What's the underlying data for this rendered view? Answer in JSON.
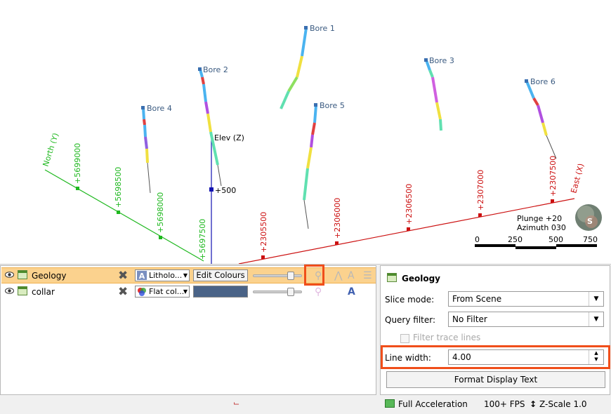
{
  "viewport": {
    "bores": [
      {
        "name": "Bore 1"
      },
      {
        "name": "Bore 2"
      },
      {
        "name": "Bore 3"
      },
      {
        "name": "Bore 4"
      },
      {
        "name": "Bore 5"
      },
      {
        "name": "Bore 6"
      }
    ],
    "axes": {
      "north_label": "North (Y)",
      "east_label": "East (X)",
      "elev_label": "Elev (Z)",
      "north_ticks": [
        "+5699000",
        "+5698500",
        "+5698000",
        "+5697500"
      ],
      "east_ticks": [
        "+2305500",
        "+2306000",
        "+2306500",
        "+2307000",
        "+2307500"
      ],
      "elev_ticks": [
        "+500"
      ]
    },
    "orientation": {
      "plunge": "Plunge +20",
      "azimuth": "Azimuth 030"
    },
    "scale_bar": [
      "0",
      "250",
      "500",
      "750"
    ],
    "compass_letter": "S",
    "colors": {
      "north": "#1fb81f",
      "east": "#cc1111",
      "elev": "#1313b0"
    }
  },
  "scene_list": {
    "rows": [
      {
        "name": "Geology",
        "colour_mode": "Litholo...",
        "colour_button": "Edit Colours",
        "selected": true
      },
      {
        "name": "collar",
        "colour_mode": "Flat col...",
        "swatch": "#4a6387",
        "selected": false
      }
    ]
  },
  "properties": {
    "title": "Geology",
    "slice_mode_label": "Slice mode:",
    "slice_mode_value": "From Scene",
    "query_filter_label": "Query filter:",
    "query_filter_value": "No Filter",
    "filter_trace_label": "Filter trace lines",
    "line_width_label": "Line width:",
    "line_width_value": "4.00",
    "format_button": "Format Display Text"
  },
  "status_bar": {
    "acceleration": "Full Acceleration",
    "fps": "100+ FPS",
    "zscale": "Z-Scale 1.0"
  },
  "highlight_color": "#f04e1a"
}
